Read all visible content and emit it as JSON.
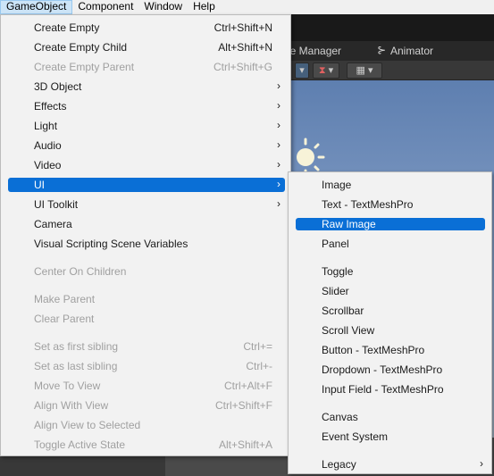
{
  "menubar": {
    "items": [
      {
        "label": "GameObject",
        "active": true
      },
      {
        "label": "Component",
        "active": false
      },
      {
        "label": "Window",
        "active": false
      },
      {
        "label": "Help",
        "active": false
      }
    ]
  },
  "editor": {
    "tabs": {
      "package_manager": "ge Manager",
      "animator": "Animator"
    },
    "toolbar": {
      "gizmo_glyph": "⧗",
      "grid_glyph": "▦"
    }
  },
  "menu": {
    "items": [
      {
        "label": "Create Empty",
        "shortcut": "Ctrl+Shift+N",
        "arrow": "",
        "disabled": false
      },
      {
        "label": "Create Empty Child",
        "shortcut": "Alt+Shift+N",
        "arrow": "",
        "disabled": false
      },
      {
        "label": "Create Empty Parent",
        "shortcut": "Ctrl+Shift+G",
        "arrow": "",
        "disabled": true
      },
      {
        "label": "3D Object",
        "shortcut": "",
        "arrow": "›",
        "disabled": false
      },
      {
        "label": "Effects",
        "shortcut": "",
        "arrow": "›",
        "disabled": false
      },
      {
        "label": "Light",
        "shortcut": "",
        "arrow": "›",
        "disabled": false
      },
      {
        "label": "Audio",
        "shortcut": "",
        "arrow": "›",
        "disabled": false
      },
      {
        "label": "Video",
        "shortcut": "",
        "arrow": "›",
        "disabled": false
      },
      {
        "label": "UI",
        "shortcut": "",
        "arrow": "›",
        "disabled": false,
        "selected": true
      },
      {
        "label": "UI Toolkit",
        "shortcut": "",
        "arrow": "›",
        "disabled": false
      },
      {
        "label": "Camera",
        "shortcut": "",
        "arrow": "",
        "disabled": false
      },
      {
        "label": "Visual Scripting Scene Variables",
        "shortcut": "",
        "arrow": "",
        "disabled": false
      },
      {
        "label": "Center On Children",
        "shortcut": "",
        "arrow": "",
        "disabled": true
      },
      {
        "label": "Make Parent",
        "shortcut": "",
        "arrow": "",
        "disabled": true
      },
      {
        "label": "Clear Parent",
        "shortcut": "",
        "arrow": "",
        "disabled": true
      },
      {
        "label": "Set as first sibling",
        "shortcut": "Ctrl+=",
        "arrow": "",
        "disabled": true
      },
      {
        "label": "Set as last sibling",
        "shortcut": "Ctrl+-",
        "arrow": "",
        "disabled": true
      },
      {
        "label": "Move To View",
        "shortcut": "Ctrl+Alt+F",
        "arrow": "",
        "disabled": true
      },
      {
        "label": "Align With View",
        "shortcut": "Ctrl+Shift+F",
        "arrow": "",
        "disabled": true
      },
      {
        "label": "Align View to Selected",
        "shortcut": "",
        "arrow": "",
        "disabled": true
      },
      {
        "label": "Toggle Active State",
        "shortcut": "Alt+Shift+A",
        "arrow": "",
        "disabled": true
      }
    ]
  },
  "submenu": {
    "items": [
      {
        "label": "Image",
        "arrow": ""
      },
      {
        "label": "Text - TextMeshPro",
        "arrow": ""
      },
      {
        "label": "Raw Image",
        "arrow": "",
        "selected": true
      },
      {
        "label": "Panel",
        "arrow": ""
      },
      {
        "label": "Toggle",
        "arrow": ""
      },
      {
        "label": "Slider",
        "arrow": ""
      },
      {
        "label": "Scrollbar",
        "arrow": ""
      },
      {
        "label": "Scroll View",
        "arrow": ""
      },
      {
        "label": "Button - TextMeshPro",
        "arrow": ""
      },
      {
        "label": "Dropdown - TextMeshPro",
        "arrow": ""
      },
      {
        "label": "Input Field - TextMeshPro",
        "arrow": ""
      },
      {
        "label": "Canvas",
        "arrow": ""
      },
      {
        "label": "Event System",
        "arrow": ""
      },
      {
        "label": "Legacy",
        "arrow": "›"
      }
    ]
  }
}
